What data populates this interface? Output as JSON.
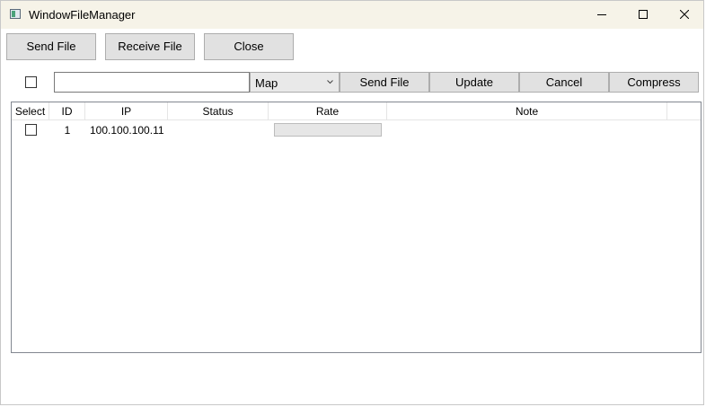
{
  "window": {
    "title": "WindowFileManager"
  },
  "toolbar": {
    "send_file_label": "Send File",
    "receive_file_label": "Receive File",
    "close_label": "Close"
  },
  "action_row": {
    "select_all_checked": false,
    "path_input_value": "",
    "mode_select_value": "Map",
    "send_file_label": "Send File",
    "update_label": "Update",
    "cancel_label": "Cancel",
    "compress_label": "Compress"
  },
  "table": {
    "columns": [
      "Select",
      "ID",
      "IP",
      "Status",
      "Rate",
      "Note"
    ],
    "rows": [
      {
        "selected": false,
        "id": "1",
        "ip": "100.100.100.11",
        "status": "",
        "rate_progress": 0,
        "note": ""
      }
    ]
  }
}
